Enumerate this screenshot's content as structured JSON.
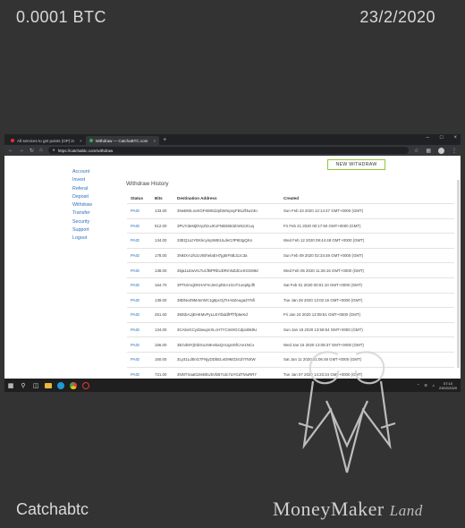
{
  "overlay": {
    "amount": "0.0001 BTC",
    "date": "23/2/2020",
    "site_name": "Catchabtc",
    "brand": {
      "part1": "MoneyMaker",
      "part2": "Land"
    }
  },
  "browser": {
    "tabs": [
      {
        "label": "All services to get points (OP) in",
        "close": "×"
      },
      {
        "label": "Withdraw — CatchaBTC.com",
        "close": "×"
      }
    ],
    "new_tab": "+",
    "window_controls": [
      "–",
      "□",
      "×"
    ],
    "url": "https://catchabtc.com/withdraw"
  },
  "page": {
    "nav": [
      "Account",
      "Invest",
      "Referal",
      "Deposit",
      "Withdraw",
      "Transfer",
      "Security",
      "Support",
      "Logout"
    ],
    "new_withdraw_label": "NEW WITHDRAW",
    "history_title": "Withdraw History",
    "columns": [
      "Status",
      "Bits",
      "Destination Address",
      "Created"
    ],
    "rows": [
      {
        "status": "PAID",
        "bits": "133.00",
        "address": "3NeBWLnoKGF6WEdJpbWmpsyFB1Zf4wz3n",
        "created": "Sun Feb 23 2020 12:14:47 GMT+0000 (GMT)"
      },
      {
        "status": "PAID",
        "bits": "512.00",
        "address": "3PUYdeMjDVyZtzuJK1FNB3663ZmN3JCuq",
        "created": "Fri Feb 21 2020 00:17:50 GMT+0000 (GMT)"
      },
      {
        "status": "PAID",
        "bits": "134.00",
        "address": "33EQ1ozYEKkcympW6tULdeCrtP6t3gQKs",
        "created": "Wed Feb 12 2020 09:44:48 GMT+0000 (GMT)"
      },
      {
        "status": "PAID",
        "bits": "178.00",
        "address": "3NktXA1fszLVBrhelaEH7jg5rF6BJ1zc3a",
        "created": "Sun Feb 09 2020 02:34:48 GMT+0000 (GMT)"
      },
      {
        "status": "PAID",
        "bits": "138.00",
        "address": "35ja1LEwVrLTuCfBPRbUDRmNZdCeSGG89d",
        "created": "Wed Feb 05 2020 11:26:16 GMT+0000 (GMT)"
      },
      {
        "status": "PAID",
        "bits": "164.70",
        "address": "3PTtXmcjDKHAFmJmCphEA1GoT1oepkjofh",
        "created": "Sat Feb 01 2020 00:01:10 GMT+0000 (GMT)"
      },
      {
        "status": "PAID",
        "bits": "139.00",
        "address": "38DNeZ9M4nrWC1g8pcGjTHA6Zeuga3YNfi",
        "created": "Tue Jan 28 2020 13:02:16 GMT+0000 (GMT)"
      },
      {
        "status": "PAID",
        "bits": "251.00",
        "address": "3MSbAJjEHKMvPyLLEYtbddfPfTfp6eKd",
        "created": "Fri Jan 24 2020 13:09:51 GMT+0000 (GMT)"
      },
      {
        "status": "PAID",
        "bits": "134.00",
        "address": "3CAbvGCyd3wupnXLcH7YCm8rGCdpi45k9U",
        "created": "Sun Jan 19 2020 13:59:54 GMT+0000 (GMT)"
      },
      {
        "status": "PAID",
        "bits": "156.00",
        "address": "3Ezvb9YjDiDXu2s9nvkaQAUgsr5fCAe1NCx",
        "created": "Wed Jan 15 2020 13:08:37 GMT+0000 (GMT)"
      },
      {
        "status": "PAID",
        "bits": "160.00",
        "address": "3Ly31Ld5nG7FNjyDDbELeD9MZ341hTNXW",
        "created": "Sat Jan 11 2020 21:06:48 GMT+0000 (GMT)"
      },
      {
        "status": "PAID",
        "bits": "721.00",
        "address": "3NNTXaatt19eBbUbVbB7cdc7aYGdTMuRR7",
        "created": "Tue Jan 07 2020 14:23:24 GMT+0000 (GMT)"
      }
    ]
  },
  "taskbar": {
    "time": "07:10",
    "date": "23/02/2020"
  }
}
